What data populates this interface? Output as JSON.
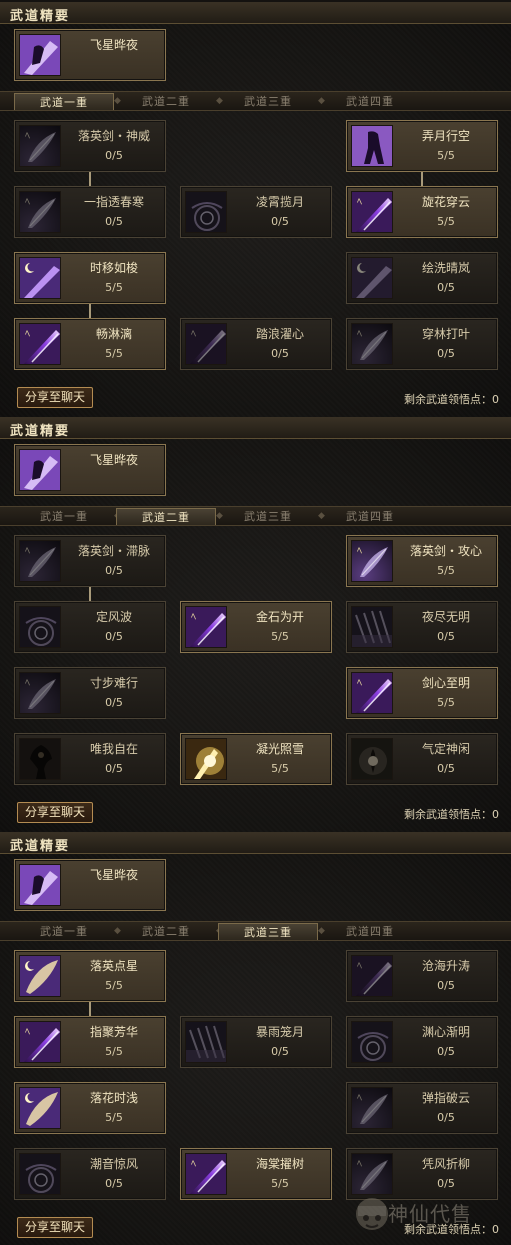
{
  "panels": [
    {
      "essence_title": "武道精要",
      "essence_skill": "飞星晔夜",
      "tabs": [
        "武道一重",
        "武道二重",
        "武道三重",
        "武道四重"
      ],
      "active_tab": 0,
      "share_button": "分享至聊天",
      "points_label": "剩余武道领悟点：0",
      "nodes": [
        {
          "name": "落英剑・神威",
          "level": "0/5",
          "learned": false,
          "icon": "feather-icon"
        },
        {
          "name": "弄月行空",
          "level": "5/5",
          "learned": true,
          "icon": "shadow-figure-icon"
        },
        {
          "name": "一指透春寒",
          "level": "0/5",
          "learned": false,
          "icon": "feather-icon"
        },
        {
          "name": "凌霄揽月",
          "level": "0/5",
          "learned": false,
          "icon": "swirl-icon"
        },
        {
          "name": "旋花穿云",
          "level": "5/5",
          "learned": true,
          "icon": "sword-slash-icon"
        },
        {
          "name": "时移如梭",
          "level": "5/5",
          "learned": true,
          "icon": "moon-slash-icon"
        },
        {
          "name": "绘洗晴岚",
          "level": "0/5",
          "learned": false,
          "icon": "moon-slash-icon"
        },
        {
          "name": "畅淋漓",
          "level": "5/5",
          "learned": true,
          "icon": "sword-slash-icon"
        },
        {
          "name": "踏浪濯心",
          "level": "0/5",
          "learned": false,
          "icon": "sword-slash-icon"
        },
        {
          "name": "穿林打叶",
          "level": "0/5",
          "learned": false,
          "icon": "feather-icon"
        }
      ]
    },
    {
      "essence_title": "武道精要",
      "essence_skill": "飞星晔夜",
      "tabs": [
        "武道一重",
        "武道二重",
        "武道三重",
        "武道四重"
      ],
      "active_tab": 1,
      "share_button": "分享至聊天",
      "points_label": "剩余武道领悟点：0",
      "nodes": [
        {
          "name": "落英剑・滞脉",
          "level": "0/5",
          "learned": false,
          "icon": "feather-icon"
        },
        {
          "name": "落英剑・攻心",
          "level": "5/5",
          "learned": true,
          "icon": "feather-icon"
        },
        {
          "name": "定风波",
          "level": "0/5",
          "learned": false,
          "icon": "swirl-icon"
        },
        {
          "name": "金石为开",
          "level": "5/5",
          "learned": true,
          "icon": "sword-slash-icon"
        },
        {
          "name": "夜尽无明",
          "level": "0/5",
          "learned": false,
          "icon": "rain-icon"
        },
        {
          "name": "寸步难行",
          "level": "0/5",
          "learned": false,
          "icon": "feather-icon"
        },
        {
          "name": "剑心至明",
          "level": "5/5",
          "learned": true,
          "icon": "sword-slash-icon"
        },
        {
          "name": "唯我自在",
          "level": "0/5",
          "learned": false,
          "icon": "tree-figure-icon"
        },
        {
          "name": "凝光照雪",
          "level": "5/5",
          "learned": true,
          "icon": "golden-burst-icon"
        },
        {
          "name": "气定神闲",
          "level": "0/5",
          "learned": false,
          "icon": "aura-icon"
        }
      ]
    },
    {
      "essence_title": "武道精要",
      "essence_skill": "飞星晔夜",
      "tabs": [
        "武道一重",
        "武道二重",
        "武道三重",
        "武道四重"
      ],
      "active_tab": 2,
      "share_button": "分享至聊天",
      "points_label": "剩余武道领悟点：0",
      "nodes": [
        {
          "name": "落英点星",
          "level": "5/5",
          "learned": true,
          "icon": "moon-feather-icon"
        },
        {
          "name": "沧海升涛",
          "level": "0/5",
          "learned": false,
          "icon": "sword-slash-icon"
        },
        {
          "name": "指聚芳华",
          "level": "5/5",
          "learned": true,
          "icon": "sword-slash-icon"
        },
        {
          "name": "暴雨笼月",
          "level": "0/5",
          "learned": false,
          "icon": "rain-icon"
        },
        {
          "name": "渊心渐明",
          "level": "0/5",
          "learned": false,
          "icon": "swirl-icon"
        },
        {
          "name": "落花时浅",
          "level": "5/5",
          "learned": true,
          "icon": "moon-feather-icon"
        },
        {
          "name": "弹指破云",
          "level": "0/5",
          "learned": false,
          "icon": "feather-icon"
        },
        {
          "name": "潮音惊风",
          "level": "0/5",
          "learned": false,
          "icon": "swirl-icon"
        },
        {
          "name": "海棠擢树",
          "level": "5/5",
          "learned": true,
          "icon": "sword-slash-icon"
        },
        {
          "name": "凭风折柳",
          "level": "0/5",
          "learned": false,
          "icon": "feather-icon"
        }
      ]
    }
  ],
  "watermark": "神仙代售"
}
